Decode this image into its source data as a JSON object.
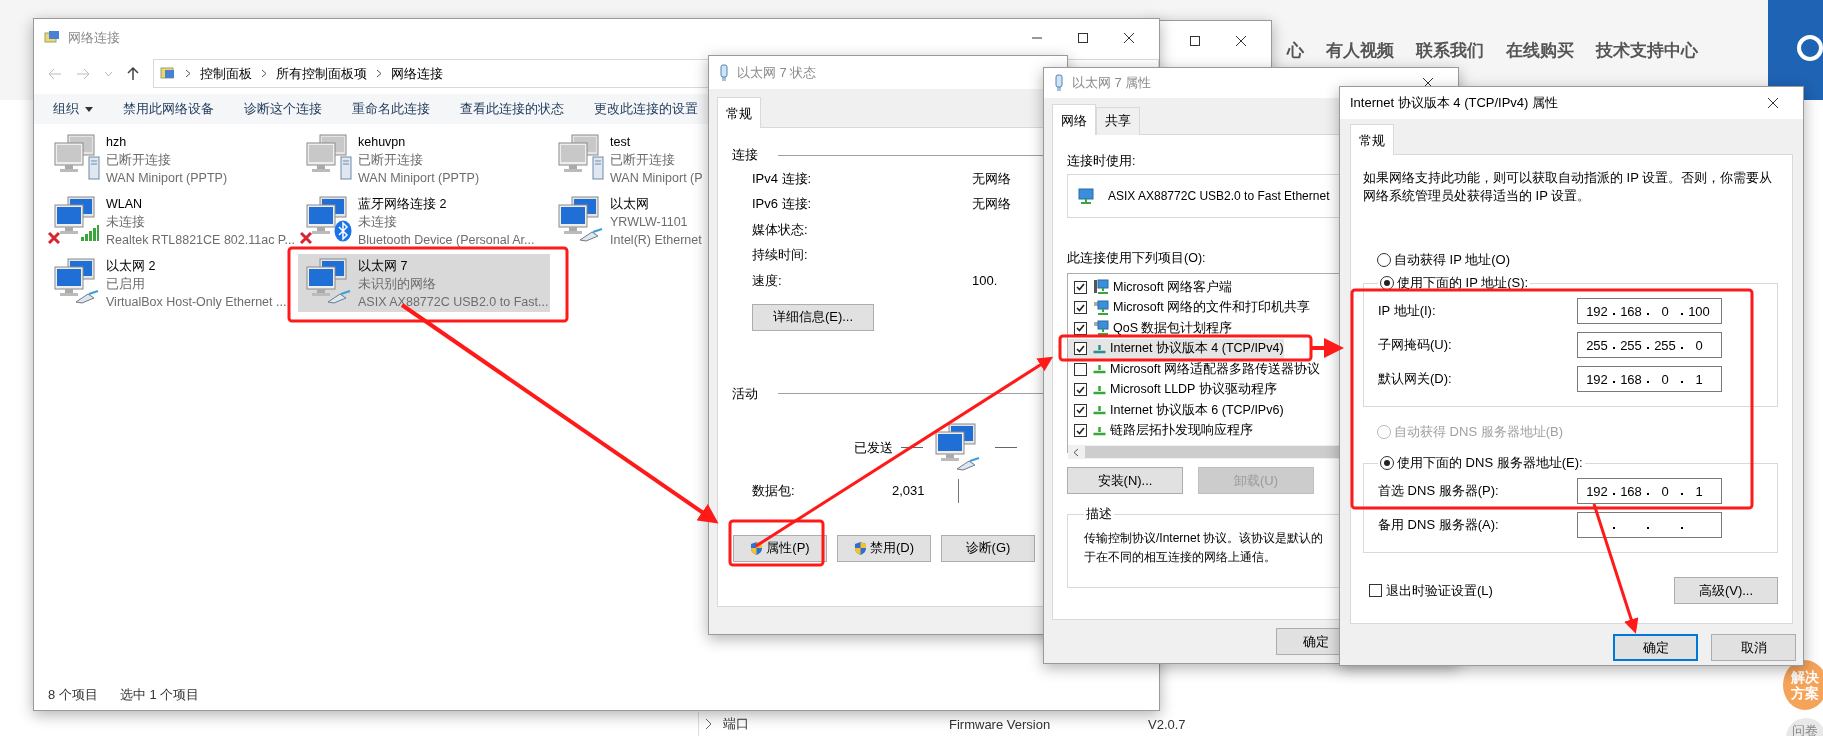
{
  "web_page": {
    "nav_items": [
      "心",
      "有人视频",
      "联系我们",
      "在线购买",
      "技术支持中心"
    ],
    "side_item": "端口",
    "firmware_label": "Firmware Version",
    "firmware_value": "V2.0.7",
    "float_buttons": [
      "解决方案",
      "问卷"
    ]
  },
  "explorer": {
    "title": "网络连接",
    "breadcrumb": [
      "控制面板",
      "所有控制面板项",
      "网络连接"
    ],
    "toolbar": [
      {
        "label": "组织",
        "dropdown": true
      },
      {
        "label": "禁用此网络设备",
        "dropdown": false
      },
      {
        "label": "诊断这个连接",
        "dropdown": false
      },
      {
        "label": "重命名此连接",
        "dropdown": false
      },
      {
        "label": "查看此连接的状态",
        "dropdown": false
      },
      {
        "label": "更改此连接的设置",
        "dropdown": false
      }
    ],
    "items": [
      {
        "name": "hzh",
        "status": "已断开连接",
        "device": "WAN Miniport (PPTP)",
        "kind": "vpn",
        "error": false,
        "selected": false
      },
      {
        "name": "kehuvpn",
        "status": "已断开连接",
        "device": "WAN Miniport (PPTP)",
        "kind": "vpn",
        "error": false,
        "selected": false
      },
      {
        "name": "test",
        "status": "已断开连接",
        "device": "WAN Miniport (P",
        "kind": "vpn",
        "error": false,
        "selected": false
      },
      {
        "name": "WLAN",
        "status": "未连接",
        "device": "Realtek RTL8821CE 802.11ac P...",
        "kind": "wifi",
        "error": true,
        "selected": false
      },
      {
        "name": "蓝牙网络连接 2",
        "status": "未连接",
        "device": "Bluetooth Device (Personal Ar...",
        "kind": "bluetooth",
        "error": true,
        "selected": false
      },
      {
        "name": "以太网",
        "status": "YRWLW-1101",
        "device": "Intel(R) Ethernet",
        "kind": "ethernet",
        "error": false,
        "selected": false
      },
      {
        "name": "以太网 2",
        "status": "已启用",
        "device": "VirtualBox Host-Only Ethernet ...",
        "kind": "ethernet",
        "error": false,
        "selected": false
      },
      {
        "name": "以太网 7",
        "status": "未识别的网络",
        "device": "ASIX AX88772C USB2.0 to Fast...",
        "kind": "ethernet",
        "error": false,
        "selected": true
      }
    ],
    "status_bar": [
      "8 个项目",
      "选中 1 个项目"
    ]
  },
  "status_dialog": {
    "title": "以太网 7 状态",
    "tabs": [
      {
        "label": "常规",
        "selected": true
      }
    ],
    "connection_title": "连接",
    "rows": [
      {
        "label": "IPv4 连接:",
        "value": "无网络"
      },
      {
        "label": "IPv6 连接:",
        "value": "无网络"
      },
      {
        "label": "媒体状态:"
      },
      {
        "label": "持续时间:"
      },
      {
        "label": "速度:",
        "value": "100."
      }
    ],
    "details_button": "详细信息(E)...",
    "activity_title": "活动",
    "sent_label": "已发送",
    "packets_label": "数据包:",
    "packets_sent": "2,031",
    "buttons": [
      {
        "label": "属性(P)",
        "shield": true
      },
      {
        "label": "禁用(D)",
        "shield": true
      },
      {
        "label": "诊断(G)",
        "shield": false
      }
    ]
  },
  "properties_dialog": {
    "title": "以太网 7 属性",
    "tabs": [
      {
        "label": "网络",
        "selected": true
      },
      {
        "label": "共享",
        "selected": false
      }
    ],
    "connect_using_label": "连接时使用:",
    "adapter": "ASIX AX88772C USB2.0 to Fast Ethernet",
    "items_label": "此连接使用下列项目(O):",
    "components": [
      {
        "label": "Microsoft 网络客户端",
        "kind": "client",
        "checked": true,
        "selected": false
      },
      {
        "label": "Microsoft 网络的文件和打印机共享",
        "kind": "service",
        "checked": true,
        "selected": false
      },
      {
        "label": "QoS 数据包计划程序",
        "kind": "service",
        "checked": true,
        "selected": false
      },
      {
        "label": "Internet 协议版本 4 (TCP/IPv4)",
        "kind": "protocol",
        "checked": true,
        "selected": true
      },
      {
        "label": "Microsoft 网络适配器多路传送器协议",
        "kind": "protocol",
        "checked": false,
        "selected": false
      },
      {
        "label": "Microsoft LLDP 协议驱动程序",
        "kind": "protocol",
        "checked": true,
        "selected": false
      },
      {
        "label": "Internet 协议版本 6 (TCP/IPv6)",
        "kind": "protocol",
        "checked": true,
        "selected": false
      },
      {
        "label": "链路层拓扑发现响应程序",
        "kind": "protocol",
        "checked": true,
        "selected": false
      }
    ],
    "buttons": [
      {
        "label": "安装(N)...",
        "disabled": false
      },
      {
        "label": "卸载(U)",
        "disabled": true
      }
    ],
    "description_title": "描述",
    "description_lines": [
      "传输控制协议/Internet 协议。该协议是默认的",
      "于在不同的相互连接的网络上通信。"
    ],
    "ok_button": "确定"
  },
  "ipv4_dialog": {
    "title": "Internet 协议版本 4 (TCP/IPv4) 属性",
    "tabs": [
      {
        "label": "常规",
        "selected": true
      }
    ],
    "intro": "如果网络支持此功能，则可以获取自动指派的 IP 设置。否则，你需要从网络系统管理员处获得适当的 IP 设置。",
    "ip_modes": [
      {
        "label": "自动获得 IP 地址(O)",
        "selected": false,
        "disabled": false
      },
      {
        "label": "使用下面的 IP 地址(S):",
        "selected": true,
        "disabled": false
      }
    ],
    "ip_fields": [
      {
        "label": "IP 地址(I):",
        "octets": [
          "192",
          "168",
          "0",
          "100"
        ]
      },
      {
        "label": "子网掩码(U):",
        "octets": [
          "255",
          "255",
          "255",
          "0"
        ]
      },
      {
        "label": "默认网关(D):",
        "octets": [
          "192",
          "168",
          "0",
          "1"
        ]
      }
    ],
    "dns_modes": [
      {
        "label": "自动获得 DNS 服务器地址(B)",
        "selected": false,
        "disabled": true
      },
      {
        "label": "使用下面的 DNS 服务器地址(E):",
        "selected": true,
        "disabled": false
      }
    ],
    "dns_fields": [
      {
        "label": "首选 DNS 服务器(P):",
        "octets": [
          "192",
          "168",
          "0",
          "1"
        ]
      },
      {
        "label": "备用 DNS 服务器(A):"
      }
    ],
    "validate": {
      "label": "退出时验证设置(L)",
      "checked": false
    },
    "advanced_button": "高级(V)...",
    "buttons": [
      {
        "label": "确定",
        "default": true
      },
      {
        "label": "取消",
        "default": false
      }
    ]
  }
}
